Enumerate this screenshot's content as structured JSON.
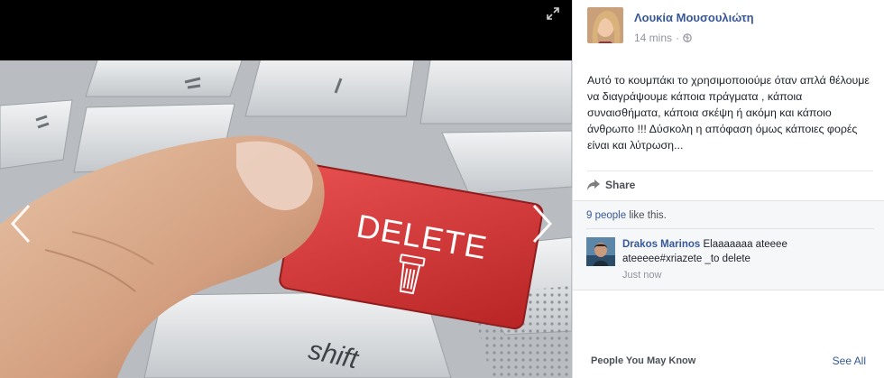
{
  "viewer": {
    "expand_icon": "fullscreen-expand-icon",
    "prev_icon": "chevron-left-icon",
    "next_icon": "chevron-right-icon",
    "photo": {
      "key_label": "DELETE",
      "shift_label": "shift",
      "key_color": "#d83a3a"
    }
  },
  "post": {
    "author_name": "Λουκία Μουσουλιώτη",
    "time": "14 mins",
    "separator": "·",
    "privacy_icon": "globe-icon",
    "text": "Αυτό το κουμπάκι το χρησιμοποιούμε όταν απλά θέλουμε να διαγράψουμε κάποια πράγματα , κάποια συναισθήματα, κάποια σκέψη ή ακόμη και κάποιο άνθρωπο !!! Δύσκολη η απόφαση όμως κάποιες φορές είναι και λύτρωση...",
    "share_label": "Share"
  },
  "feedback": {
    "likes_link": "9 people",
    "likes_suffix": " like this.",
    "comment": {
      "author": "Drakos Marinos",
      "text": " Elaaaaaaa ateeee ateeeee#xriazete _to delete",
      "time": "Just now"
    }
  },
  "sidebar": {
    "pymk_title": "People You May Know",
    "see_all": "See All"
  },
  "colors": {
    "link": "#365899",
    "panel_bg": "#ffffff",
    "feedback_bg": "#f6f7f9"
  }
}
